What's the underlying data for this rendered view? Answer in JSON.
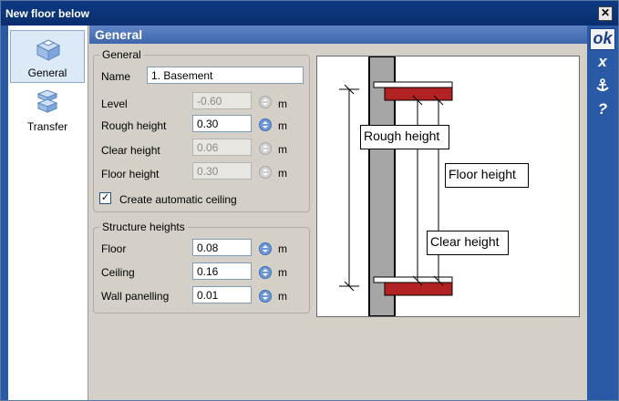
{
  "window": {
    "title": "New floor below"
  },
  "sidebar": {
    "items": [
      {
        "label": "General",
        "selected": true,
        "icon": "floor-general-icon"
      },
      {
        "label": "Transfer",
        "selected": false,
        "icon": "floor-transfer-icon"
      }
    ]
  },
  "header": {
    "title": "General"
  },
  "right_bar": {
    "ok_label": "ok",
    "cancel_label": "x",
    "anchor_icon": "anchor-icon",
    "help_label": "?"
  },
  "general": {
    "legend": "General",
    "name_label": "Name",
    "name_value": "1. Basement",
    "level_label": "Level",
    "level_value": "-0.60",
    "rough_label": "Rough height",
    "rough_value": "0.30",
    "clear_label": "Clear height",
    "clear_value": "0.06",
    "floor_height_label": "Floor height",
    "floor_height_value": "0.30",
    "unit": "m",
    "auto_ceiling_label": "Create automatic ceiling",
    "auto_ceiling_checked": true
  },
  "structure": {
    "legend": "Structure heights",
    "floor_label": "Floor",
    "floor_value": "0.08",
    "ceiling_label": "Ceiling",
    "ceiling_value": "0.16",
    "wall_label": "Wall panelling",
    "wall_value": "0.01",
    "unit": "m"
  },
  "diagram": {
    "rough_label": "Rough height",
    "floor_label": "Floor height",
    "clear_label": "Clear height",
    "colors": {
      "slab": "#b22222",
      "wall": "#a6a6a6"
    }
  }
}
